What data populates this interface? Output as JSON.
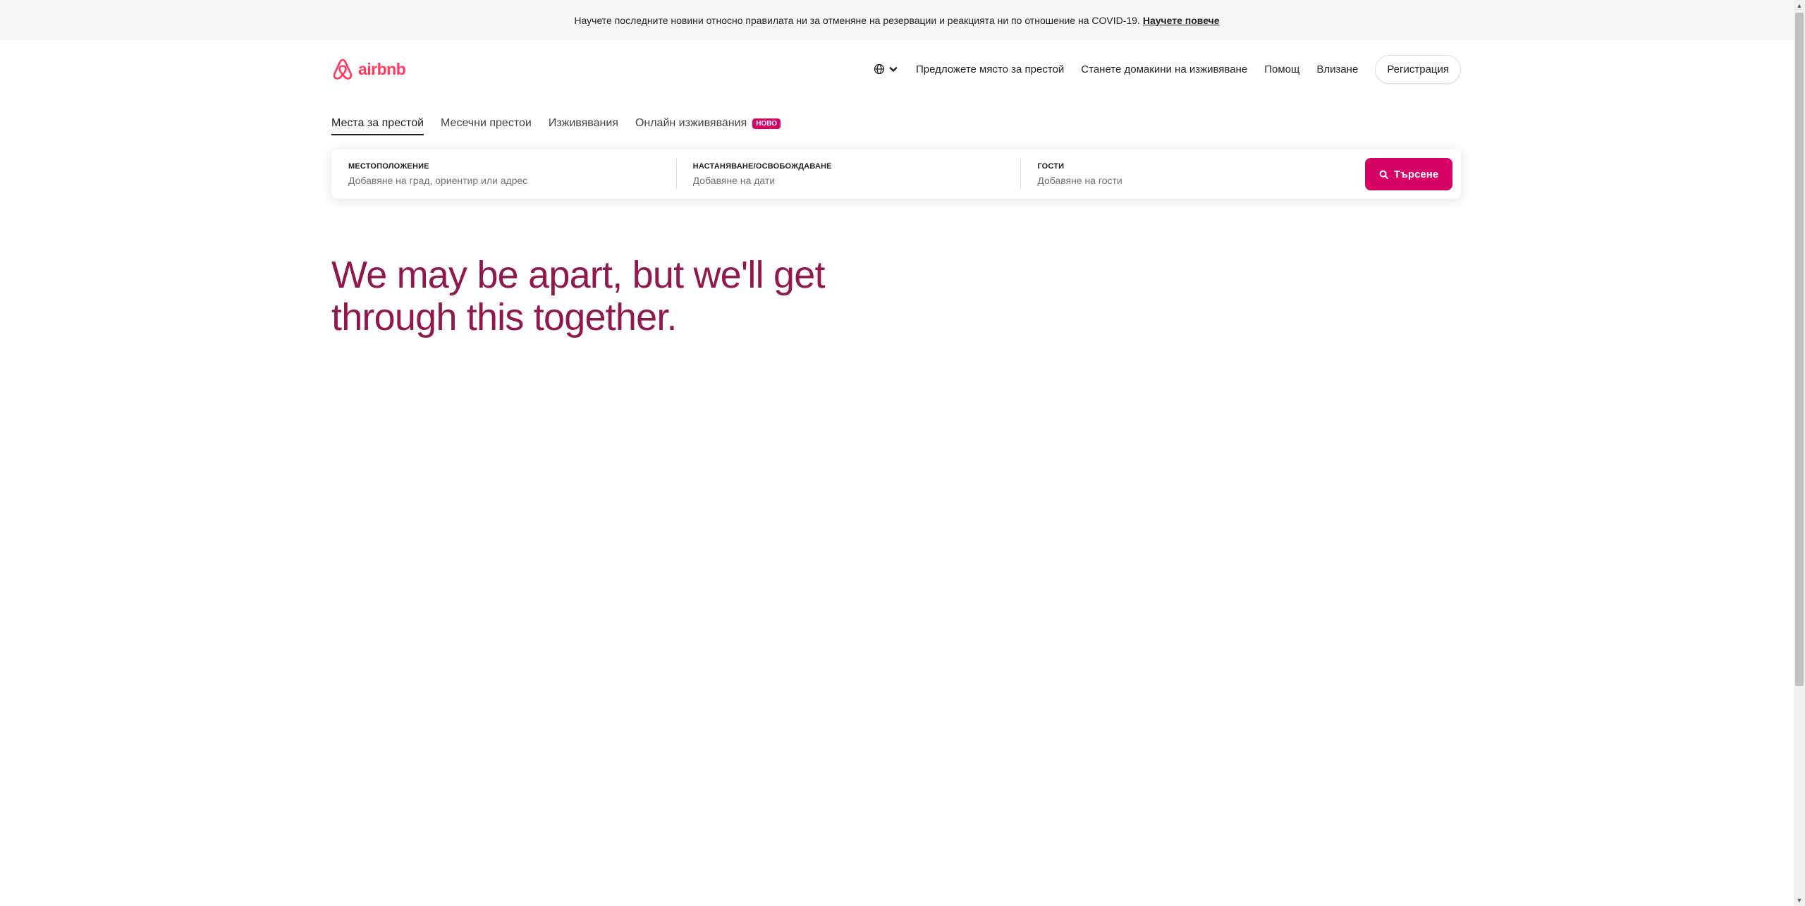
{
  "banner": {
    "text": "Научете последните новини относно правилата ни за отменяне на резервации и реакцията ни по отношение на COVID-19.",
    "link": "Научете повече"
  },
  "header": {
    "logo_text": "airbnb",
    "nav": {
      "host_place": "Предложете място за престой",
      "host_experience": "Станете домакини на изживяване",
      "help": "Помощ",
      "login": "Влизане",
      "register": "Регистрация"
    }
  },
  "tabs": [
    {
      "label": "Места за престой",
      "active": true
    },
    {
      "label": "Месечни престои",
      "active": false
    },
    {
      "label": "Изживявания",
      "active": false
    },
    {
      "label": "Онлайн изживявания",
      "active": false,
      "badge": "НОВО"
    }
  ],
  "search": {
    "location": {
      "label": "МЕСТОПОЛОЖЕНИЕ",
      "placeholder": "Добавяне на град, ориентир или адрес"
    },
    "dates": {
      "label": "НАСТАНЯВАНЕ/ОСВОБОЖДАВАНЕ",
      "placeholder": "Добавяне на дати"
    },
    "guests": {
      "label": "ГОСТИ",
      "placeholder": "Добавяне на гости"
    },
    "button_label": "Търсене"
  },
  "hero": {
    "line1": "We may be apart, but we'll get",
    "line2": "through this together."
  },
  "colors": {
    "brand": "#ff385c",
    "accent": "#d70466",
    "hero_text": "#92174d"
  }
}
